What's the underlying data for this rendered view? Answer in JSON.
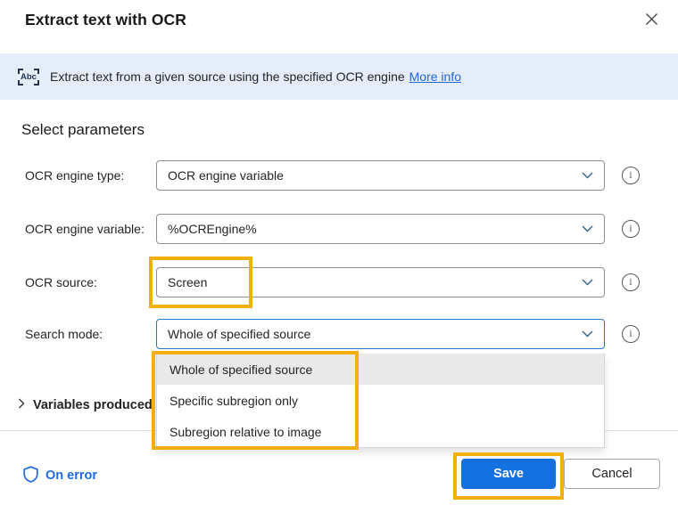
{
  "dialog": {
    "title": "Extract text with OCR"
  },
  "banner": {
    "icon_text": "Abc",
    "text": "Extract text from a given source using the specified OCR engine",
    "link_label": "More info"
  },
  "section": {
    "heading": "Select parameters"
  },
  "form": {
    "rows": [
      {
        "label": "OCR engine type:",
        "value": "OCR engine variable"
      },
      {
        "label": "OCR engine variable:",
        "value": "%OCREngine%"
      },
      {
        "label": "OCR source:",
        "value": "Screen"
      },
      {
        "label": "Search mode:",
        "value": "Whole of specified source"
      }
    ]
  },
  "dropdown_menu": {
    "options": [
      {
        "label": "Whole of specified source"
      },
      {
        "label": "Specific subregion only"
      },
      {
        "label": "Subregion relative to image"
      }
    ],
    "selected_index": 0
  },
  "variables_section": {
    "label": "Variables produced"
  },
  "footer": {
    "on_error_label": "On error",
    "save_label": "Save",
    "cancel_label": "Cancel"
  },
  "colors": {
    "accent_blue": "#1570e0",
    "link_blue": "#2368dd",
    "on_error_blue": "#2169e8",
    "focus_border_blue": "#2177cc",
    "banner_background": "#e4edf9",
    "highlight_orange": "#F2AF0D",
    "selected_option_gray": "#e9e9e9"
  }
}
